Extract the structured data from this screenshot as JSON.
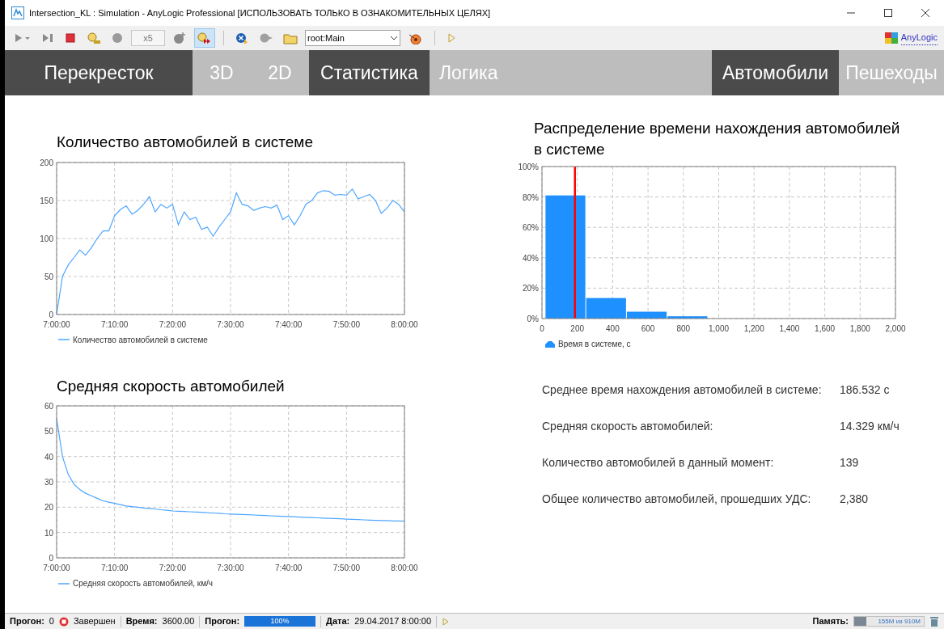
{
  "window": {
    "title": "Intersection_KL : Simulation - AnyLogic Professional [ИСПОЛЬЗОВАТЬ ТОЛЬКО В ОЗНАКОМИТЕЛЬНЫХ ЦЕЛЯХ]"
  },
  "toolbar": {
    "buttons": [
      {
        "kind": "run",
        "selected": false
      },
      {
        "kind": "step",
        "selected": false
      },
      {
        "kind": "stop",
        "selected": false
      },
      {
        "kind": "realtime",
        "selected": false
      },
      {
        "kind": "slower",
        "selected": false
      },
      {
        "kind": "speed",
        "text": "x5"
      },
      {
        "kind": "faster",
        "selected": false
      },
      {
        "kind": "virtual",
        "selected": true
      },
      {
        "kind": "sep"
      },
      {
        "kind": "inspect",
        "selected": false
      },
      {
        "kind": "navigate",
        "selected": false
      },
      {
        "kind": "root",
        "selected": false
      },
      {
        "kind": "selector",
        "text": "root:Main"
      },
      {
        "kind": "camera",
        "selected": false
      },
      {
        "kind": "sep"
      },
      {
        "kind": "console",
        "selected": false
      }
    ],
    "logo_link": "AnyLogic"
  },
  "nav": [
    {
      "label": "Перекресток",
      "selected": true
    },
    {
      "label": "3D",
      "selected": false
    },
    {
      "label": "2D",
      "selected": false
    },
    {
      "label": "Статистика",
      "selected": true
    },
    {
      "label": "Логика",
      "selected": false
    },
    {
      "label": "Автомобили",
      "selected": true
    },
    {
      "label": "Пешеходы",
      "selected": false
    }
  ],
  "left_charts": [
    {
      "title": "Количество автомобилей в системе",
      "chart_data": {
        "type": "line",
        "grid": true,
        "ylim": [
          0,
          200
        ],
        "yticks": [
          0,
          50,
          100,
          150,
          200
        ],
        "categories": [
          "7:00:00",
          null,
          null,
          null,
          null,
          null,
          null,
          null,
          null,
          null,
          "7:10:00",
          null,
          null,
          null,
          null,
          null,
          null,
          null,
          null,
          null,
          "7:20:00",
          null,
          null,
          null,
          null,
          null,
          null,
          null,
          null,
          null,
          "7:30:00",
          null,
          null,
          null,
          null,
          null,
          null,
          null,
          null,
          null,
          "7:40:00",
          null,
          null,
          null,
          null,
          null,
          null,
          null,
          null,
          null,
          "7:50:00",
          null,
          null,
          null,
          null,
          null,
          null,
          null,
          null,
          null,
          "8:00:00"
        ],
        "series": [
          {
            "name": "Количество автомобилей в системе",
            "color": "#4da6ff",
            "values": [
              0,
              50,
              65,
              75,
              85,
              78,
              88,
              100,
              110,
              110,
              130,
              138,
              143,
              132,
              137,
              145,
              155,
              135,
              145,
              140,
              145,
              118,
              135,
              125,
              128,
              112,
              115,
              103,
              115,
              125,
              135,
              160,
              145,
              143,
              137,
              140,
              142,
              140,
              144,
              125,
              130,
              118,
              130,
              145,
              150,
              160,
              163,
              162,
              157,
              158,
              157,
              165,
              152,
              155,
              158,
              150,
              133,
              140,
              150,
              145,
              135
            ]
          }
        ]
      }
    },
    {
      "title": "Средняя скорость автомобилей",
      "chart_data": {
        "type": "line",
        "grid": true,
        "ylim": [
          0,
          60
        ],
        "yticks": [
          0,
          10,
          20,
          30,
          40,
          50,
          60
        ],
        "categories": [
          "7:00:00",
          null,
          null,
          null,
          null,
          null,
          null,
          null,
          null,
          null,
          "7:10:00",
          null,
          null,
          null,
          null,
          null,
          null,
          null,
          null,
          null,
          "7:20:00",
          null,
          null,
          null,
          null,
          null,
          null,
          null,
          null,
          null,
          "7:30:00",
          null,
          null,
          null,
          null,
          null,
          null,
          null,
          null,
          null,
          "7:40:00",
          null,
          null,
          null,
          null,
          null,
          null,
          null,
          null,
          null,
          "7:50:00",
          null,
          null,
          null,
          null,
          null,
          null,
          null,
          null,
          null,
          "8:00:00"
        ],
        "series": [
          {
            "name": "Средняя скорость автомобилей, км/ч",
            "color": "#4da6ff",
            "values": [
              55,
              40,
              33,
              29,
              27,
              25.5,
              24.5,
              23.5,
              22.5,
              22,
              21.5,
              21,
              20.5,
              20.2,
              20,
              19.7,
              19.5,
              19.3,
              19,
              18.8,
              18.5,
              18.4,
              18.3,
              18.2,
              18.1,
              18,
              17.8,
              17.7,
              17.6,
              17.4,
              17.3,
              17.2,
              17.1,
              17,
              16.9,
              16.8,
              16.7,
              16.6,
              16.5,
              16.4,
              16.3,
              16.2,
              16.1,
              16,
              15.9,
              15.8,
              15.7,
              15.6,
              15.5,
              15.4,
              15.3,
              15.2,
              15.1,
              15,
              14.9,
              14.8,
              14.7,
              14.7,
              14.6,
              14.6,
              14.5
            ]
          }
        ]
      }
    }
  ],
  "histogram": {
    "title": "Распределение времени нахождения автомобилей в системе",
    "chart_data": {
      "type": "bar",
      "grid": true,
      "xlim": [
        0,
        2000
      ],
      "ylim": [
        0,
        1
      ],
      "xticks": [
        0,
        200,
        400,
        600,
        800,
        {
          "value": 1000,
          "label": "1,000"
        },
        {
          "value": 1200,
          "label": "1,200"
        },
        {
          "value": 1400,
          "label": "1,400"
        },
        {
          "value": 1600,
          "label": "1,600"
        },
        {
          "value": 1800,
          "label": "1,800"
        },
        {
          "value": 2000,
          "label": "2,000"
        }
      ],
      "yticks": [
        {
          "value": 0,
          "label": "0%"
        },
        {
          "value": 0.2,
          "label": "20%"
        },
        {
          "value": 0.4,
          "label": "40%"
        },
        {
          "value": 0.6,
          "label": "60%"
        },
        {
          "value": 0.8,
          "label": "80%"
        },
        {
          "value": 1,
          "label": "100%"
        }
      ],
      "x": [
        135,
        365,
        595,
        825
      ],
      "series": [
        {
          "name": "Время в системе, с",
          "color": "#1e90ff",
          "values": [
            0.81,
            0.135,
            0.045,
            0.015
          ]
        }
      ],
      "ref_lines": [
        {
          "axis": "x",
          "value": 186.532,
          "color": "#ff0000"
        }
      ]
    }
  },
  "stats": [
    {
      "label": "Среднее время нахождения автомобилей в системе:",
      "value": "186.532",
      "unit": "с"
    },
    {
      "label": "Средняя скорость автомобилей:",
      "value": "14.329",
      "unit": "км/ч"
    },
    {
      "label": "Количество автомобилей в данный момент:",
      "value": "139"
    },
    {
      "label": "Общее количество автомобилей, прошедших УДС:",
      "value": "2,380"
    }
  ],
  "status_bar": {
    "run_label": "Прогон:",
    "run": "0",
    "state": "Завершен",
    "time_label": "Время:",
    "time": "3600.00",
    "progress_label": "Прогон:",
    "progress": {
      "level": 1,
      "text": "100%"
    },
    "date_label": "Дата:",
    "date": "29.04.2017 8:00:00",
    "memory_label": "Память:",
    "memory": {
      "level": 0.17,
      "text": "155M из 910M"
    }
  }
}
